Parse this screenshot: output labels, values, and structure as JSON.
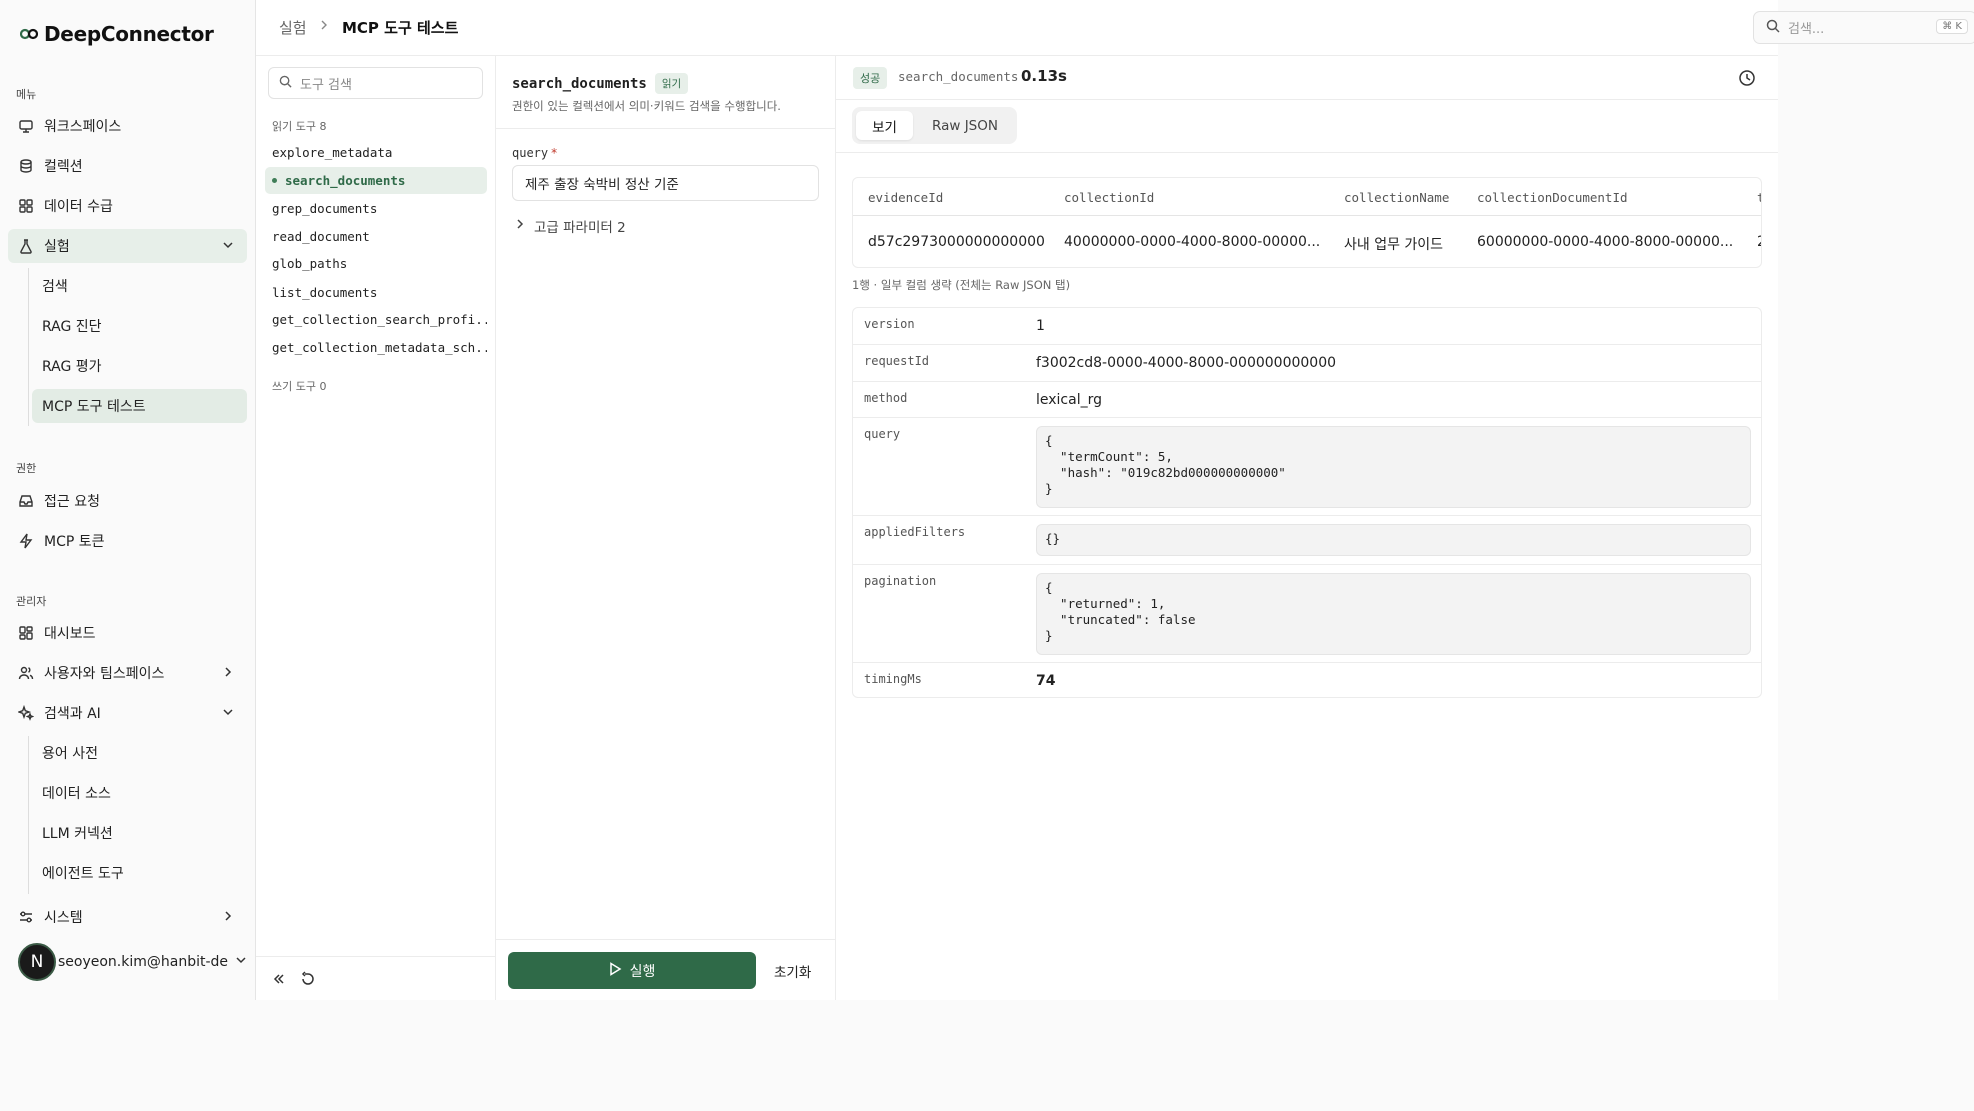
{
  "brand": {
    "name": "DeepConnector"
  },
  "sidebar": {
    "menu_label": "메뉴",
    "menu": [
      {
        "label": "워크스페이스",
        "icon": "monitor-icon"
      },
      {
        "label": "컬렉션",
        "icon": "database-icon"
      },
      {
        "label": "데이터 수급",
        "icon": "grid-icon"
      },
      {
        "label": "실험",
        "icon": "flask-icon"
      }
    ],
    "experiment_sub": [
      {
        "label": "검색"
      },
      {
        "label": "RAG 진단"
      },
      {
        "label": "RAG 평가"
      },
      {
        "label": "MCP 도구 테스트"
      }
    ],
    "perm_label": "권한",
    "perm": [
      {
        "label": "접근 요청",
        "icon": "inbox-icon"
      },
      {
        "label": "MCP 토큰",
        "icon": "bolt-icon"
      }
    ],
    "admin_label": "관리자",
    "admin": [
      {
        "label": "대시보드",
        "icon": "dashboard-icon"
      },
      {
        "label": "사용자와 팀스페이스",
        "icon": "users-icon"
      },
      {
        "label": "검색과 AI",
        "icon": "sparkles-icon"
      }
    ],
    "ai_sub": [
      {
        "label": "용어 사전"
      },
      {
        "label": "데이터 소스"
      },
      {
        "label": "LLM 커넥션"
      },
      {
        "label": "에이전트 도구"
      }
    ],
    "system": {
      "label": "시스템",
      "icon": "settings-sliders-icon"
    },
    "user": {
      "initial": "N",
      "email": "seoyeon.kim@hanbit-de..."
    }
  },
  "header": {
    "breadcrumb": [
      "실험",
      "MCP 도구 테스트"
    ],
    "search_placeholder": "검색...",
    "shortcut": "⌘ K"
  },
  "tools": {
    "search_placeholder": "도구 검색",
    "read_label": "읽기 도구 8",
    "read_tools": [
      "explore_metadata",
      "search_documents",
      "grep_documents",
      "read_document",
      "glob_paths",
      "list_documents",
      "get_collection_search_profi...",
      "get_collection_metadata_sch..."
    ],
    "selected": "search_documents",
    "write_label": "쓰기 도구 0"
  },
  "form": {
    "tool_name": "search_documents",
    "badge": "읽기",
    "description": "권한이 있는 컬렉션에서 의미·키워드 검색을 수행합니다.",
    "field_label": "query",
    "field_required": "*",
    "field_value": "제주 출장 숙박비 정산 기준",
    "advanced": "고급 파라미터 2",
    "run": "실행",
    "reset": "초기화"
  },
  "result": {
    "status": "성공",
    "tool": "search_documents",
    "time": "0.13s",
    "tabs": [
      "보기",
      "Raw JSON"
    ],
    "active_tab": "보기",
    "columns": [
      "evidenceId",
      "collectionId",
      "collectionName",
      "collectionDocumentId",
      "t"
    ],
    "rows": [
      [
        "d57c2973000000000000",
        "40000000-0000-4000-8000-00000...",
        "사내 업무 가이드",
        "60000000-0000-4000-8000-00000...",
        "2"
      ]
    ],
    "note": "1행 · 일부 컬럼 생략 (전체는 Raw JSON 탭)",
    "fields": [
      {
        "key": "version",
        "value": "1"
      },
      {
        "key": "requestId",
        "value": "f3002cd8-0000-4000-8000-000000000000"
      },
      {
        "key": "method",
        "value": "lexical_rg"
      },
      {
        "key": "query",
        "code": "{\n  \"termCount\": 5,\n  \"hash\": \"019c82bd000000000000\"\n}"
      },
      {
        "key": "appliedFilters",
        "code": "{}"
      },
      {
        "key": "pagination",
        "code": "{\n  \"returned\": 1,\n  \"truncated\": false\n}"
      },
      {
        "key": "timingMs",
        "value": "74"
      }
    ]
  },
  "colors": {
    "accent": "#2f6a48",
    "accent_bg": "#e7efe9"
  }
}
